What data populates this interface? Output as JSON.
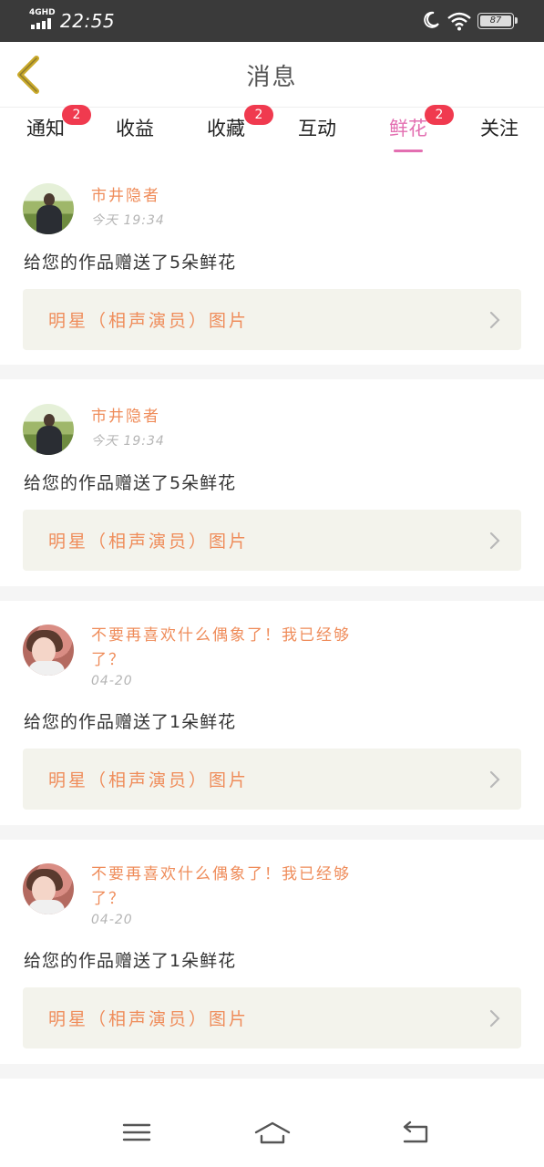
{
  "status_bar": {
    "network": "4GHD",
    "time": "22:55",
    "battery": "87",
    "icons": [
      "signal-icon",
      "moon-icon",
      "wifi-icon",
      "battery-icon"
    ]
  },
  "header": {
    "title": "消息",
    "back_icon": "chevron-left-icon"
  },
  "tabs": [
    {
      "label": "通知",
      "badge": "2",
      "active": false
    },
    {
      "label": "收益",
      "badge": "",
      "active": false
    },
    {
      "label": "收藏",
      "badge": "2",
      "active": false
    },
    {
      "label": "互动",
      "badge": "",
      "active": false
    },
    {
      "label": "鲜花",
      "badge": "2",
      "active": true
    },
    {
      "label": "关注",
      "badge": "",
      "active": false
    }
  ],
  "messages": [
    {
      "user": "市井隐者",
      "time": "今天 19:34",
      "text": "给您的作品赠送了5朵鲜花",
      "work": "明星（相声演员）图片"
    },
    {
      "user": "市井隐者",
      "time": "今天 19:34",
      "text": "给您的作品赠送了5朵鲜花",
      "work": "明星（相声演员）图片"
    },
    {
      "user": "不要再喜欢什么偶象了！我已经够了？",
      "time": "04-20",
      "text": "给您的作品赠送了1朵鲜花",
      "work": "明星（相声演员）图片"
    },
    {
      "user": "不要再喜欢什么偶象了！我已经够了？",
      "time": "04-20",
      "text": "给您的作品赠送了1朵鲜花",
      "work": "明星（相声演员）图片"
    }
  ],
  "nav": {
    "icons": [
      "menu-icon",
      "home-icon",
      "back-icon"
    ]
  },
  "colors": {
    "accent": "#e36fb1",
    "badge": "#f03a4f",
    "username": "#ef8c5a",
    "card_bg": "#f3f3ec",
    "status_bar": "#3a3a3a"
  }
}
